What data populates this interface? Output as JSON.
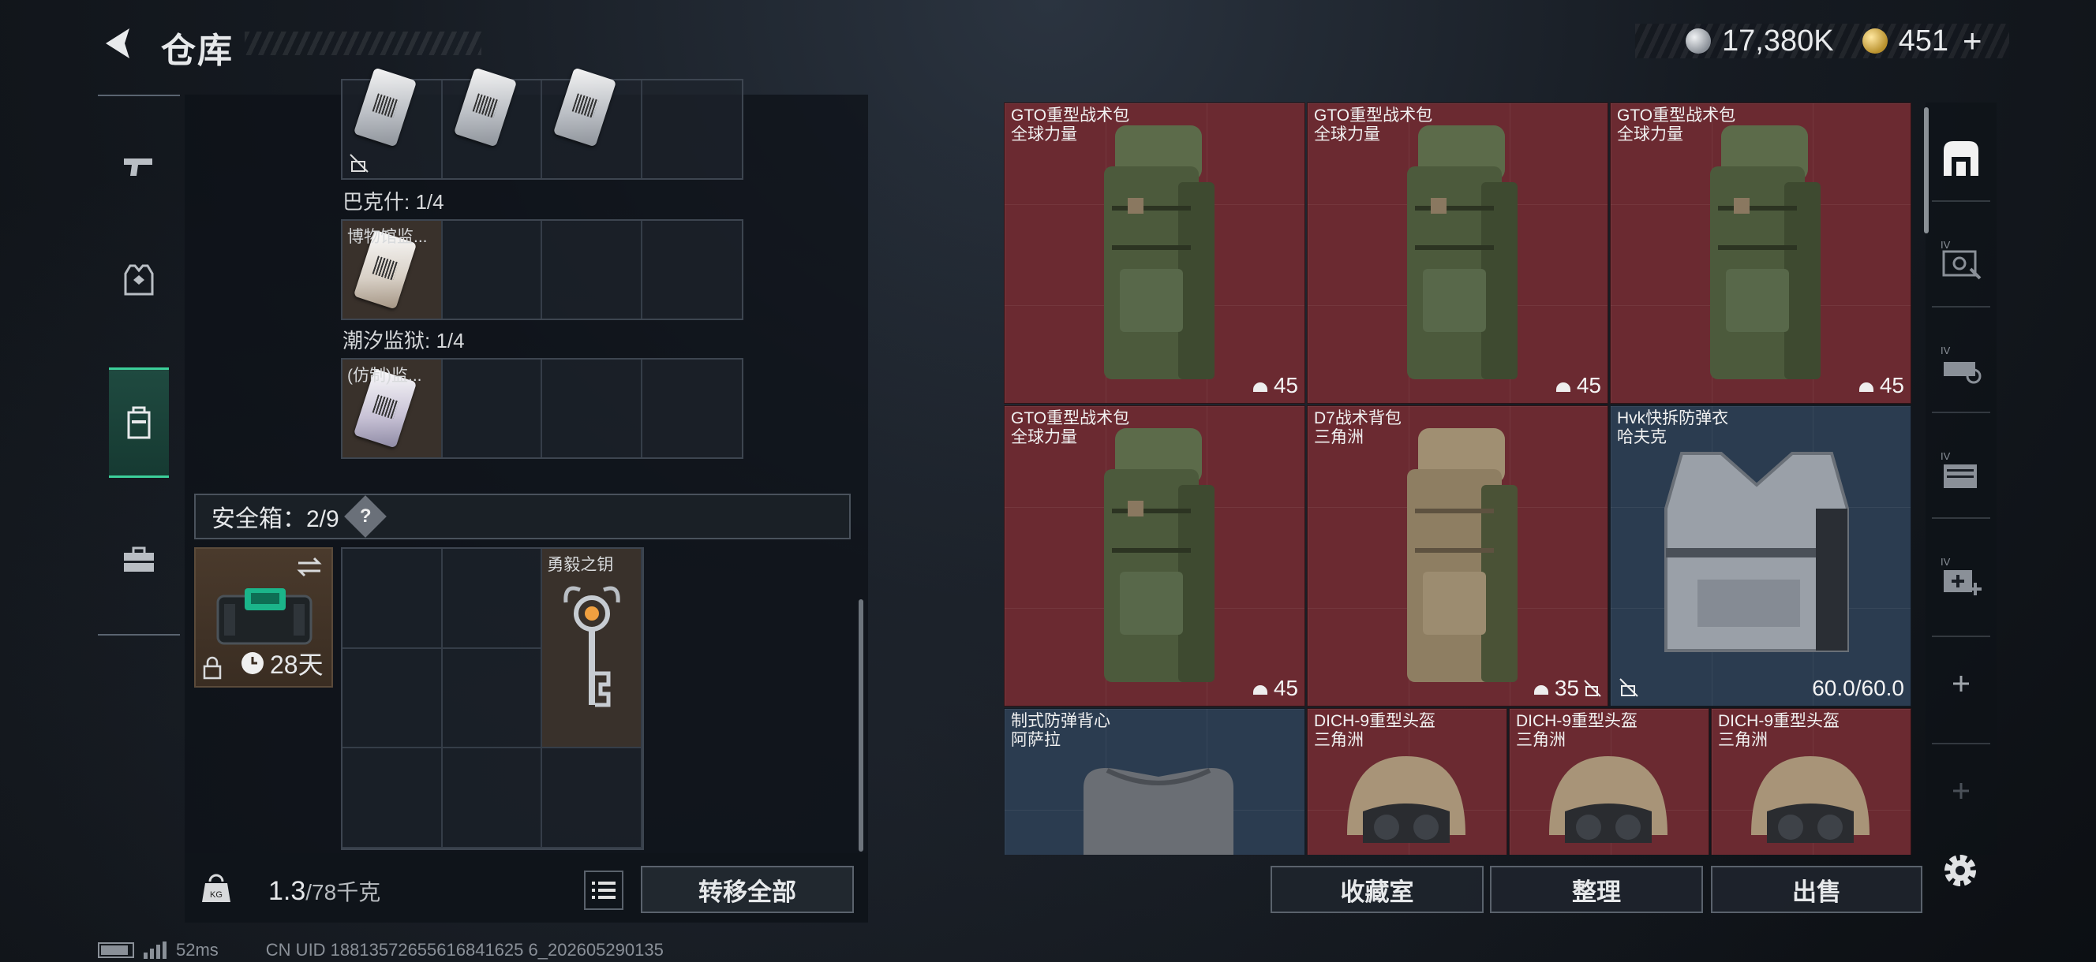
{
  "header": {
    "title": "仓库",
    "currency_silver": "17,380K",
    "currency_gold": "451",
    "plus": "+"
  },
  "left_tabs": [
    {
      "icon": "pistol-icon"
    },
    {
      "icon": "vest-icon"
    },
    {
      "icon": "backpack-icon",
      "active": true
    },
    {
      "icon": "toolbox-icon"
    }
  ],
  "left_panel": {
    "group_bakesh": "巴克什: 1/4",
    "group_bakesh_item": "博物馆监...",
    "group_tide": "潮汐监狱: 1/4",
    "group_tide_item": "(仿制)监...",
    "safe_box_label": "安全箱：2/9",
    "help": "?",
    "safe_timer": "28天",
    "key_name": "勇毅之钥",
    "weight_value": "1.3",
    "weight_unit": "/78千克",
    "transfer_all": "转移全部"
  },
  "items": [
    {
      "name": "GTO重型战术包",
      "sub": "全球力量",
      "dur": "45"
    },
    {
      "name": "GTO重型战术包",
      "sub": "全球力量",
      "dur": "45"
    },
    {
      "name": "GTO重型战术包",
      "sub": "全球力量",
      "dur": "45"
    },
    {
      "name": "GTO重型战术包",
      "sub": "全球力量",
      "dur": "45"
    },
    {
      "name": "D7战术背包",
      "sub": "三角洲",
      "dur": "35"
    },
    {
      "name": "Hvk快拆防弹衣",
      "sub": "哈夫克",
      "dur": "60.0/60.0"
    },
    {
      "name": "制式防弹背心",
      "sub": "阿萨拉"
    },
    {
      "name": "DICH-9重型头盔",
      "sub": "三角洲"
    },
    {
      "name": "DICH-9重型头盔",
      "sub": "三角洲"
    },
    {
      "name": "DICH-9重型头盔",
      "sub": "三角洲"
    }
  ],
  "right_footer": {
    "collection": "收藏室",
    "sort": "整理",
    "sell": "出售"
  },
  "right_tabs": [
    {
      "icon": "stash-icon",
      "label": ""
    },
    {
      "icon": "rank-iv-gun-icon",
      "label": "IV"
    },
    {
      "icon": "rank-iv-car-icon",
      "label": "IV"
    },
    {
      "icon": "rank-iv-folder-icon",
      "label": "IV"
    },
    {
      "icon": "rank-iv-medkit-icon",
      "label": "IV"
    }
  ],
  "status_bar": {
    "ping": "52ms",
    "uid": "CN UID 18813572655616841625 6_202605290135"
  },
  "colors": {
    "accent": "#3ccf9a",
    "item_red": "#6b2a31",
    "item_blue": "#2b3c50"
  }
}
